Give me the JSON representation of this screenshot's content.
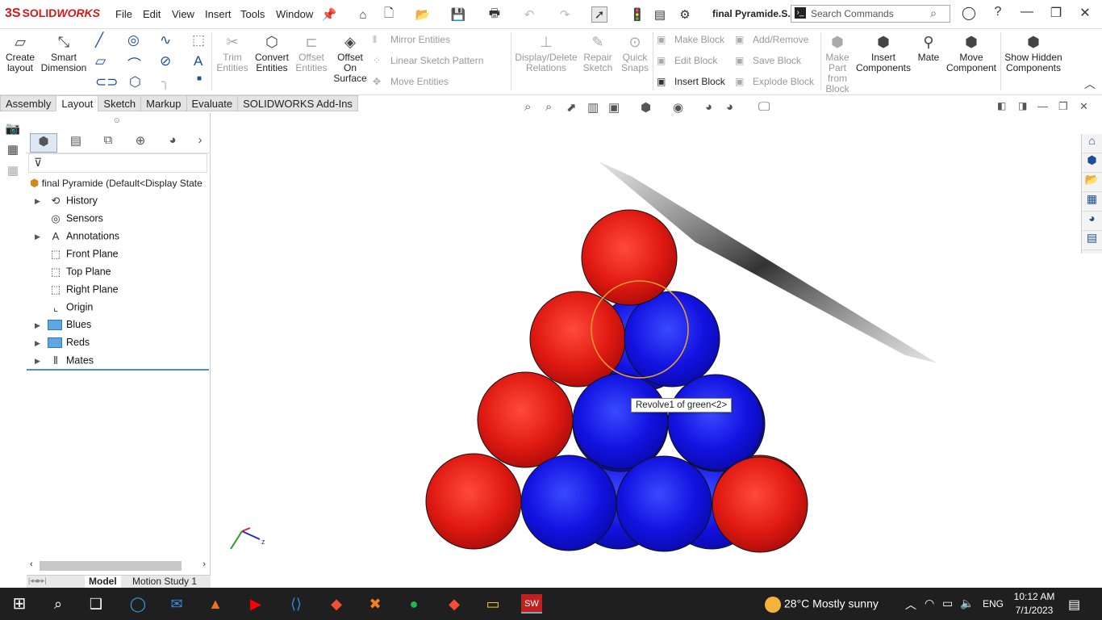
{
  "app": {
    "brand_ds": "3S",
    "brand_name": "SOLID",
    "brand_name2": "WORKS",
    "doc_title": "final Pyramide.S..."
  },
  "menu": [
    "File",
    "Edit",
    "View",
    "Insert",
    "Tools",
    "Window"
  ],
  "search": {
    "placeholder": "Search Commands"
  },
  "ribbon": {
    "create_layout": "Create layout",
    "smart_dimension": "Smart Dimension",
    "trim_entities": "Trim Entities",
    "convert_entities": "Convert Entities",
    "offset_entities": "Offset Entities",
    "offset_on_surface": "Offset On Surface",
    "mirror_entities": "Mirror Entities",
    "linear_sketch_pattern": "Linear Sketch Pattern",
    "move_entities": "Move Entities",
    "display_delete_relations": "Display/Delete Relations",
    "repair_sketch": "Repair Sketch",
    "quick_snaps": "Quick Snaps",
    "make_block": "Make Block",
    "edit_block": "Edit Block",
    "insert_block": "Insert Block",
    "add_remove": "Add/Remove",
    "save_block": "Save Block",
    "explode_block": "Explode Block",
    "make_part_from_block": "Make Part from Block",
    "insert_components": "Insert Components",
    "mate": "Mate",
    "move_component": "Move Component",
    "show_hidden_components": "Show Hidden Components"
  },
  "tabs": [
    "Assembly",
    "Layout",
    "Sketch",
    "Markup",
    "Evaluate",
    "SOLIDWORKS Add-Ins"
  ],
  "active_tab": "Layout",
  "tree": {
    "root": "final Pyramide  (Default<Display State",
    "items": [
      {
        "label": "History",
        "icon": "history-icon",
        "expandable": true
      },
      {
        "label": "Sensors",
        "icon": "sensor-icon",
        "expandable": false
      },
      {
        "label": "Annotations",
        "icon": "annotation-icon",
        "expandable": true
      },
      {
        "label": "Front Plane",
        "icon": "plane-icon",
        "expandable": false
      },
      {
        "label": "Top Plane",
        "icon": "plane-icon",
        "expandable": false
      },
      {
        "label": "Right Plane",
        "icon": "plane-icon",
        "expandable": false
      },
      {
        "label": "Origin",
        "icon": "origin-icon",
        "expandable": false
      },
      {
        "label": "Blues",
        "icon": "folder-icon",
        "expandable": true
      },
      {
        "label": "Reds",
        "icon": "folder-icon",
        "expandable": true
      },
      {
        "label": "Mates",
        "icon": "mates-icon",
        "expandable": true
      }
    ]
  },
  "bottom_tabs": [
    "Model",
    "Motion Study 1"
  ],
  "tooltip": "Revolve1 of green<2>",
  "colors": {
    "red_sphere": "#e02020",
    "blue_sphere": "#1a1ae0",
    "highlight": "#f0a030"
  },
  "taskbar": {
    "weather": "28°C  Mostly sunny",
    "lang": "ENG",
    "time": "10:12 AM",
    "date": "7/1/2023"
  }
}
